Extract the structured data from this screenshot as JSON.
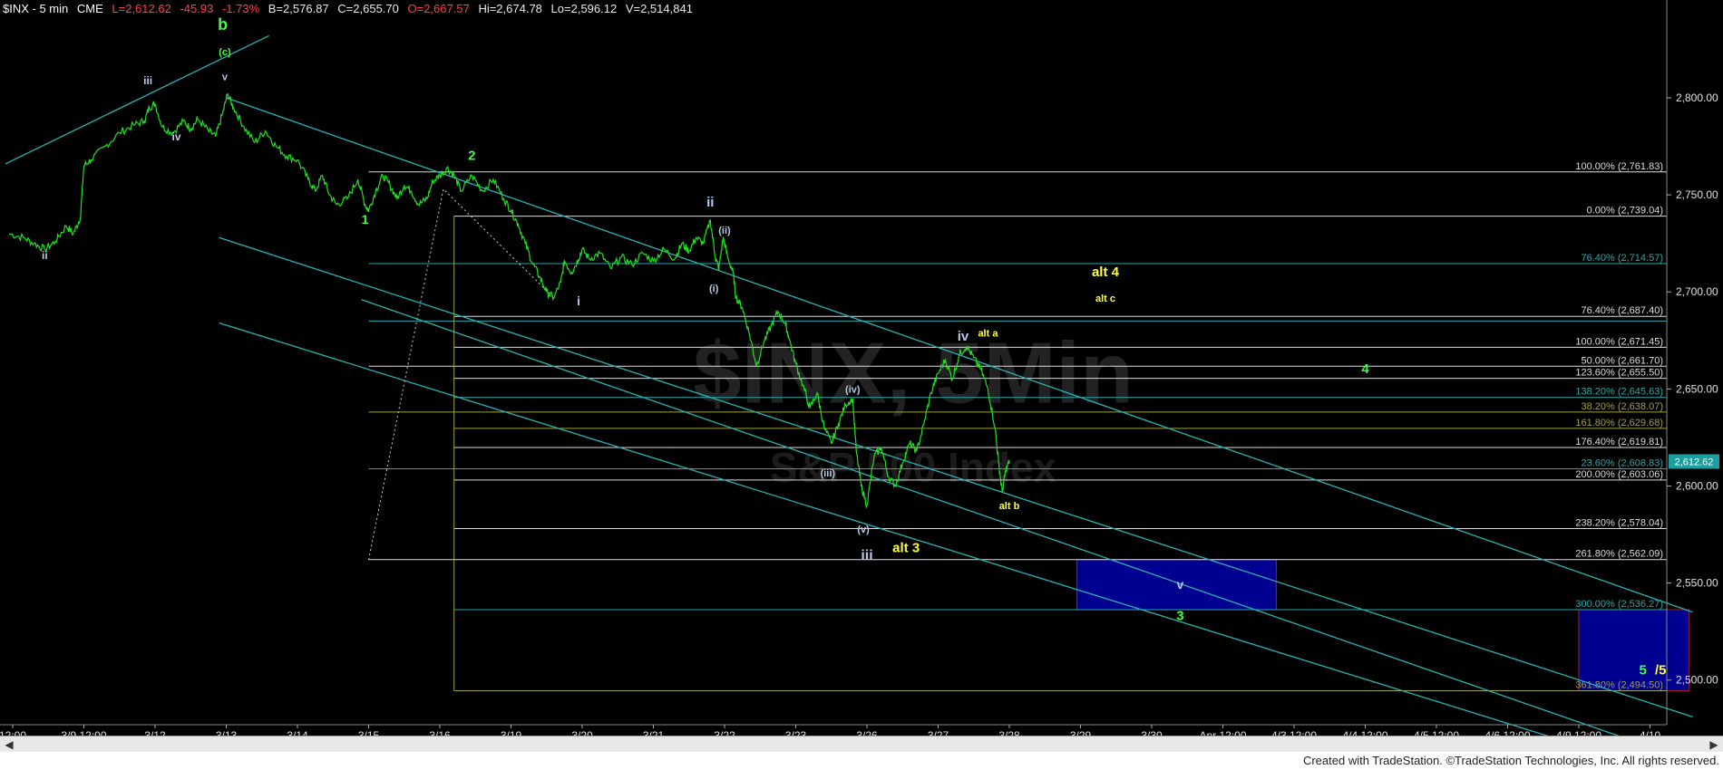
{
  "header": {
    "symbol": "$INX - 5 min",
    "exchange": "CME",
    "last": "L=2,612.62",
    "change": "-45.93",
    "change_pct": "-1.73%",
    "bid": "B=2,576.87",
    "close": "C=2,655.70",
    "open": "O=2,667.57",
    "high": "Hi=2,674.78",
    "low": "Lo=2,596.12",
    "volume": "V=2,514,841"
  },
  "watermark": {
    "symbol": "$INX, 5Min",
    "name": "S&P 500 Index"
  },
  "footer": "Created with TradeStation. ©TradeStation Technologies, Inc. All rights reserved.",
  "colors": {
    "price": "#22e022",
    "channel": "#27b3b3",
    "fib_white": "#dcdcdc",
    "fib_teal": "#2aa8a8",
    "fib_olive": "#a0a040",
    "label_light": "#b8c8e8",
    "label_green": "#40ff40",
    "label_yellow": "#ffff40",
    "target_box": "#000090",
    "last_tag": "#1aa0a0"
  },
  "chart_data": {
    "type": "line",
    "title": "$INX - 5 min",
    "subtitle": "S&P 500 Index",
    "xlabel": "",
    "ylabel": "",
    "ylim": [
      2477,
      2842
    ],
    "grid": false,
    "last_price": 2612.62,
    "last_price_label": "2,612.62",
    "y_ticks": [
      {
        "v": 2800,
        "label": "2,800.00"
      },
      {
        "v": 2750,
        "label": "2,750.00"
      },
      {
        "v": 2700,
        "label": "2,700.00"
      },
      {
        "v": 2650,
        "label": "2,650.00"
      },
      {
        "v": 2600,
        "label": "2,600.00"
      },
      {
        "v": 2550,
        "label": "2,550.00"
      },
      {
        "v": 2500,
        "label": "2,500.00"
      }
    ],
    "x_ticks": [
      {
        "t": 0.0,
        "label": "12:00"
      },
      {
        "t": 1.0,
        "label": "3/9 12:00"
      },
      {
        "t": 2.0,
        "label": "3/12"
      },
      {
        "t": 3.0,
        "label": "3/13"
      },
      {
        "t": 4.0,
        "label": "3/14"
      },
      {
        "t": 5.0,
        "label": "3/15"
      },
      {
        "t": 6.0,
        "label": "3/16"
      },
      {
        "t": 7.0,
        "label": "3/19"
      },
      {
        "t": 8.0,
        "label": "3/20"
      },
      {
        "t": 9.0,
        "label": "3/21"
      },
      {
        "t": 10.0,
        "label": "3/22"
      },
      {
        "t": 11.0,
        "label": "3/23"
      },
      {
        "t": 12.0,
        "label": "3/26"
      },
      {
        "t": 13.0,
        "label": "3/27"
      },
      {
        "t": 14.0,
        "label": "3/28"
      },
      {
        "t": 15.0,
        "label": "3/29"
      },
      {
        "t": 16.0,
        "label": "3/30"
      },
      {
        "t": 17.0,
        "label": "Apr 12:00"
      },
      {
        "t": 18.0,
        "label": "4/3 12:00"
      },
      {
        "t": 19.0,
        "label": "4/4 12:00"
      },
      {
        "t": 20.0,
        "label": "4/5 12:00"
      },
      {
        "t": 21.0,
        "label": "4/6 12:00"
      },
      {
        "t": 22.0,
        "label": "4/9 12:00"
      },
      {
        "t": 23.0,
        "label": "4/10"
      }
    ],
    "series": [
      {
        "color": "#22e022",
        "points": [
          [
            -0.05,
            2730
          ],
          [
            0.15,
            2728
          ],
          [
            0.3,
            2725
          ],
          [
            0.45,
            2722
          ],
          [
            0.6,
            2726
          ],
          [
            0.75,
            2734
          ],
          [
            0.85,
            2730
          ],
          [
            0.95,
            2738
          ],
          [
            1.0,
            2765
          ],
          [
            1.1,
            2768
          ],
          [
            1.3,
            2775
          ],
          [
            1.5,
            2782
          ],
          [
            1.7,
            2786
          ],
          [
            1.85,
            2788
          ],
          [
            1.92,
            2795
          ],
          [
            2.0,
            2797
          ],
          [
            2.1,
            2785
          ],
          [
            2.25,
            2782
          ],
          [
            2.4,
            2788
          ],
          [
            2.5,
            2784
          ],
          [
            2.6,
            2789
          ],
          [
            2.75,
            2783
          ],
          [
            2.85,
            2780
          ],
          [
            2.95,
            2792
          ],
          [
            3.02,
            2802
          ],
          [
            3.1,
            2795
          ],
          [
            3.25,
            2785
          ],
          [
            3.4,
            2777
          ],
          [
            3.55,
            2783
          ],
          [
            3.7,
            2775
          ],
          [
            3.85,
            2770
          ],
          [
            4.0,
            2768
          ],
          [
            4.15,
            2758
          ],
          [
            4.25,
            2752
          ],
          [
            4.35,
            2760
          ],
          [
            4.45,
            2750
          ],
          [
            4.55,
            2745
          ],
          [
            4.7,
            2748
          ],
          [
            4.85,
            2758
          ],
          [
            4.95,
            2745
          ],
          [
            5.0,
            2742
          ],
          [
            5.1,
            2752
          ],
          [
            5.2,
            2760
          ],
          [
            5.3,
            2755
          ],
          [
            5.4,
            2748
          ],
          [
            5.5,
            2755
          ],
          [
            5.6,
            2752
          ],
          [
            5.7,
            2745
          ],
          [
            5.82,
            2748
          ],
          [
            5.9,
            2757
          ],
          [
            6.0,
            2760
          ],
          [
            6.1,
            2764
          ],
          [
            6.2,
            2760
          ],
          [
            6.3,
            2752
          ],
          [
            6.45,
            2760
          ],
          [
            6.6,
            2752
          ],
          [
            6.75,
            2758
          ],
          [
            6.9,
            2748
          ],
          [
            7.0,
            2742
          ],
          [
            7.1,
            2735
          ],
          [
            7.2,
            2725
          ],
          [
            7.3,
            2715
          ],
          [
            7.4,
            2708
          ],
          [
            7.5,
            2700
          ],
          [
            7.6,
            2697
          ],
          [
            7.7,
            2705
          ],
          [
            7.75,
            2716
          ],
          [
            7.85,
            2710
          ],
          [
            7.95,
            2717
          ],
          [
            8.0,
            2722
          ],
          [
            8.1,
            2717
          ],
          [
            8.25,
            2720
          ],
          [
            8.4,
            2712
          ],
          [
            8.55,
            2718
          ],
          [
            8.7,
            2714
          ],
          [
            8.85,
            2720
          ],
          [
            9.0,
            2716
          ],
          [
            9.15,
            2722
          ],
          [
            9.3,
            2717
          ],
          [
            9.4,
            2725
          ],
          [
            9.5,
            2721
          ],
          [
            9.6,
            2728
          ],
          [
            9.7,
            2725
          ],
          [
            9.8,
            2737
          ],
          [
            9.87,
            2718
          ],
          [
            9.92,
            2712
          ],
          [
            9.98,
            2728
          ],
          [
            10.05,
            2717
          ],
          [
            10.12,
            2710
          ],
          [
            10.16,
            2697
          ],
          [
            10.25,
            2692
          ],
          [
            10.35,
            2678
          ],
          [
            10.45,
            2662
          ],
          [
            10.55,
            2674
          ],
          [
            10.65,
            2682
          ],
          [
            10.75,
            2690
          ],
          [
            10.85,
            2684
          ],
          [
            10.9,
            2677
          ],
          [
            11.0,
            2663
          ],
          [
            11.1,
            2652
          ],
          [
            11.2,
            2640
          ],
          [
            11.3,
            2648
          ],
          [
            11.4,
            2630
          ],
          [
            11.5,
            2622
          ],
          [
            11.6,
            2632
          ],
          [
            11.7,
            2642
          ],
          [
            11.8,
            2645
          ],
          [
            11.85,
            2618
          ],
          [
            11.92,
            2600
          ],
          [
            12.0,
            2590
          ],
          [
            12.1,
            2615
          ],
          [
            12.2,
            2620
          ],
          [
            12.3,
            2605
          ],
          [
            12.4,
            2600
          ],
          [
            12.5,
            2612
          ],
          [
            12.6,
            2622
          ],
          [
            12.7,
            2618
          ],
          [
            12.8,
            2632
          ],
          [
            12.9,
            2648
          ],
          [
            13.0,
            2658
          ],
          [
            13.1,
            2665
          ],
          [
            13.2,
            2655
          ],
          [
            13.3,
            2668
          ],
          [
            13.4,
            2672
          ],
          [
            13.5,
            2666
          ],
          [
            13.6,
            2660
          ],
          [
            13.7,
            2650
          ],
          [
            13.8,
            2630
          ],
          [
            13.85,
            2612
          ],
          [
            13.9,
            2597
          ],
          [
            13.95,
            2608
          ],
          [
            14.0,
            2613
          ]
        ]
      }
    ],
    "fib_levels": [
      {
        "v": 2761.83,
        "label": "100.00% (2,761.83)",
        "color": "#dcdcdc",
        "from": 5.0
      },
      {
        "v": 2739.04,
        "label": "0.00% (2,739.04)",
        "color": "#dcdcdc",
        "from": 6.2
      },
      {
        "v": 2714.57,
        "label": "76.40% (2,714.57)",
        "color": "#2aa8a8",
        "from": 5.0
      },
      {
        "v": 2687.4,
        "label": "76.40% (2,687.40)",
        "color": "#dcdcdc",
        "from": 6.2
      },
      {
        "v": 2685.0,
        "label": "",
        "color": "#2aa8a8",
        "from": 5.0
      },
      {
        "v": 2671.45,
        "label": "100.00% (2,671.45)",
        "color": "#dcdcdc",
        "from": 6.2
      },
      {
        "v": 2661.7,
        "label": "50.00% (2,661.70)",
        "color": "#dcdcdc",
        "from": 5.0
      },
      {
        "v": 2655.5,
        "label": "123.60% (2,655.50)",
        "color": "#dcdcdc",
        "from": 6.2
      },
      {
        "v": 2645.63,
        "label": "138.20% (2,645.63)",
        "color": "#2aa8a8",
        "from": 6.2
      },
      {
        "v": 2638.07,
        "label": "38.20% (2,638.07)",
        "color": "#a0a040",
        "from": 5.0
      },
      {
        "v": 2629.68,
        "label": "161.80% (2,629.68)",
        "color": "#a0a040",
        "from": 6.2
      },
      {
        "v": 2619.81,
        "label": "176.40% (2,619.81)",
        "color": "#dcdcdc",
        "from": 6.2
      },
      {
        "v": 2608.83,
        "label": "23.60% (2,608.83)",
        "color": "#2aa8a8",
        "from": 5.0
      },
      {
        "v": 2603.06,
        "label": "200.00% (2,603.06)",
        "color": "#dcdcdc",
        "from": 6.2
      },
      {
        "v": 2578.04,
        "label": "238.20% (2,578.04)",
        "color": "#dcdcdc",
        "from": 6.2
      },
      {
        "v": 2562.09,
        "label": "261.80% (2,562.09)",
        "color": "#dcdcdc",
        "from": 5.0
      },
      {
        "v": 2536.27,
        "label": "300.00% (2,536.27)",
        "color": "#2aa8a8",
        "from": 6.2
      },
      {
        "v": 2494.5,
        "label": "361.80% (2,494.50)",
        "color": "#a0a040",
        "from": 6.2
      }
    ],
    "channels": [
      {
        "x1": -0.1,
        "y1": 2766,
        "x2": 3.6,
        "y2": 2832
      },
      {
        "x1": 3.0,
        "y1": 2800,
        "x2": 23.6,
        "y2": 2535
      },
      {
        "x1": 2.9,
        "y1": 2728,
        "x2": 23.6,
        "y2": 2481
      },
      {
        "x1": 2.9,
        "y1": 2684,
        "x2": 23.6,
        "y2": 2448
      },
      {
        "x1": 4.9,
        "y1": 2696,
        "x2": 23.6,
        "y2": 2458
      }
    ],
    "dotted_lines": [
      [
        [
          5.0,
          2562
        ],
        [
          6.05,
          2753
        ],
        [
          7.6,
          2697
        ]
      ]
    ],
    "target_boxes": [
      {
        "x1": 14.95,
        "x2": 17.75,
        "y1": 2536.27,
        "y2": 2562.09
      },
      {
        "x1": 22.0,
        "x2": 23.55,
        "y1": 2494.5,
        "y2": 2536.27
      }
    ],
    "wave_labels": [
      {
        "t": 0.45,
        "v": 2717,
        "text": "ii",
        "color": "#b8c8e8",
        "size": 12
      },
      {
        "t": 1.9,
        "v": 2807,
        "text": "iii",
        "color": "#b8c8e8",
        "size": 12
      },
      {
        "t": 2.3,
        "v": 2778,
        "text": "iv",
        "color": "#b8c8e8",
        "size": 12
      },
      {
        "t": 2.95,
        "v": 2835,
        "text": "b",
        "color": "#40ff40",
        "size": 18
      },
      {
        "t": 2.98,
        "v": 2822,
        "text": "(c)",
        "color": "#40ff40",
        "size": 11
      },
      {
        "t": 2.98,
        "v": 2809,
        "text": "v",
        "color": "#b8c8e8",
        "size": 11
      },
      {
        "t": 4.95,
        "v": 2735,
        "text": "1",
        "color": "#40ff40",
        "size": 14
      },
      {
        "t": 6.45,
        "v": 2768,
        "text": "2",
        "color": "#40ff40",
        "size": 15
      },
      {
        "t": 7.95,
        "v": 2693,
        "text": "i",
        "color": "#b8c8e8",
        "size": 14
      },
      {
        "t": 9.8,
        "v": 2744,
        "text": "ii",
        "color": "#b8c8e8",
        "size": 15
      },
      {
        "t": 10.0,
        "v": 2730,
        "text": "(ii)",
        "color": "#b8c8e8",
        "size": 11
      },
      {
        "t": 9.85,
        "v": 2700,
        "text": "(i)",
        "color": "#b8c8e8",
        "size": 11
      },
      {
        "t": 11.8,
        "v": 2648,
        "text": "(iv)",
        "color": "#b8c8e8",
        "size": 11
      },
      {
        "t": 11.45,
        "v": 2605,
        "text": "(iii)",
        "color": "#b8c8e8",
        "size": 11
      },
      {
        "t": 11.95,
        "v": 2576,
        "text": "(v)",
        "color": "#b8c8e8",
        "size": 11
      },
      {
        "t": 12.0,
        "v": 2562,
        "text": "iii",
        "color": "#b8c8e8",
        "size": 16
      },
      {
        "t": 12.55,
        "v": 2566,
        "text": "alt 3",
        "color": "#ffff40",
        "size": 15
      },
      {
        "t": 13.35,
        "v": 2675,
        "text": "iv",
        "color": "#b8c8e8",
        "size": 15
      },
      {
        "t": 13.7,
        "v": 2677,
        "text": "alt a",
        "color": "#ffff40",
        "size": 11
      },
      {
        "t": 14.0,
        "v": 2588,
        "text": "alt b",
        "color": "#ffff40",
        "size": 11
      },
      {
        "t": 15.35,
        "v": 2708,
        "text": "alt 4",
        "color": "#ffff40",
        "size": 15
      },
      {
        "t": 15.35,
        "v": 2695,
        "text": "alt c",
        "color": "#ffff40",
        "size": 11
      },
      {
        "t": 19.0,
        "v": 2658,
        "text": "4",
        "color": "#40ff40",
        "size": 15
      },
      {
        "t": 16.4,
        "v": 2547,
        "text": "v",
        "color": "#b8c8e8",
        "size": 14
      },
      {
        "t": 16.4,
        "v": 2531,
        "text": "3",
        "color": "#40ff40",
        "size": 15
      },
      {
        "t": 22.9,
        "v": 2503,
        "text": "5",
        "color": "#40ff40",
        "size": 15
      },
      {
        "t": 23.15,
        "v": 2503,
        "text": "/5",
        "color": "#ffff40",
        "size": 15
      }
    ]
  }
}
